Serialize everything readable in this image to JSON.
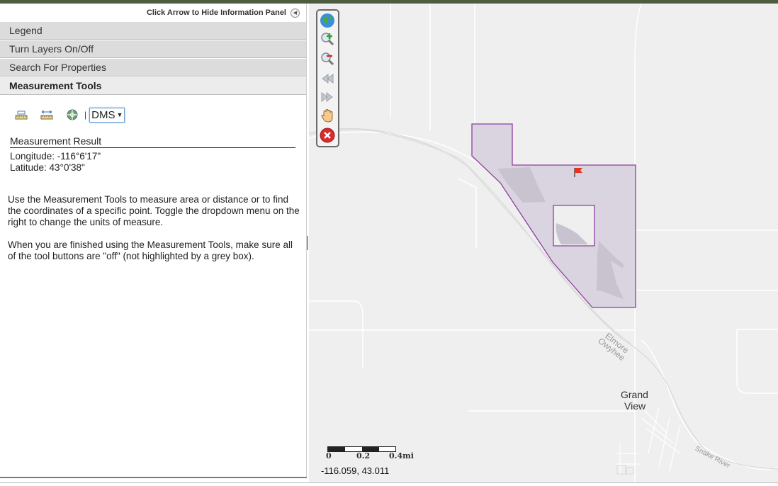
{
  "panel": {
    "hide_text": "Click Arrow to Hide Information Panel",
    "accordion": [
      {
        "label": "Legend"
      },
      {
        "label": "Turn Layers On/Off"
      },
      {
        "label": "Search For Properties"
      },
      {
        "label": "Measurement Tools"
      }
    ],
    "units_selected": "DMS",
    "result_title": "Measurement Result",
    "longitude": "Longitude: -116°6'17\"",
    "latitude": "Latitude: 43°0'38\"",
    "info_p1": "Use the Measurement Tools to measure area or distance or to find the coordinates of a specific point. Toggle the dropdown menu on the right to change the units of measure.",
    "info_p2": "When you are finished using the Measurement Tools, make sure all of the tool buttons are \"off\" (not highlighted by a grey box)."
  },
  "map": {
    "labels": {
      "rail1": "Elmore",
      "rail2": "Owyhee",
      "town1": "Grand",
      "town2": "View",
      "river": "Snake River"
    },
    "scale": {
      "s0": "0",
      "s1": "0.2",
      "s2": "0.4mi"
    },
    "mouse_coords": "-116.059, 43.011",
    "parcel_color": "#8e3f9e"
  }
}
